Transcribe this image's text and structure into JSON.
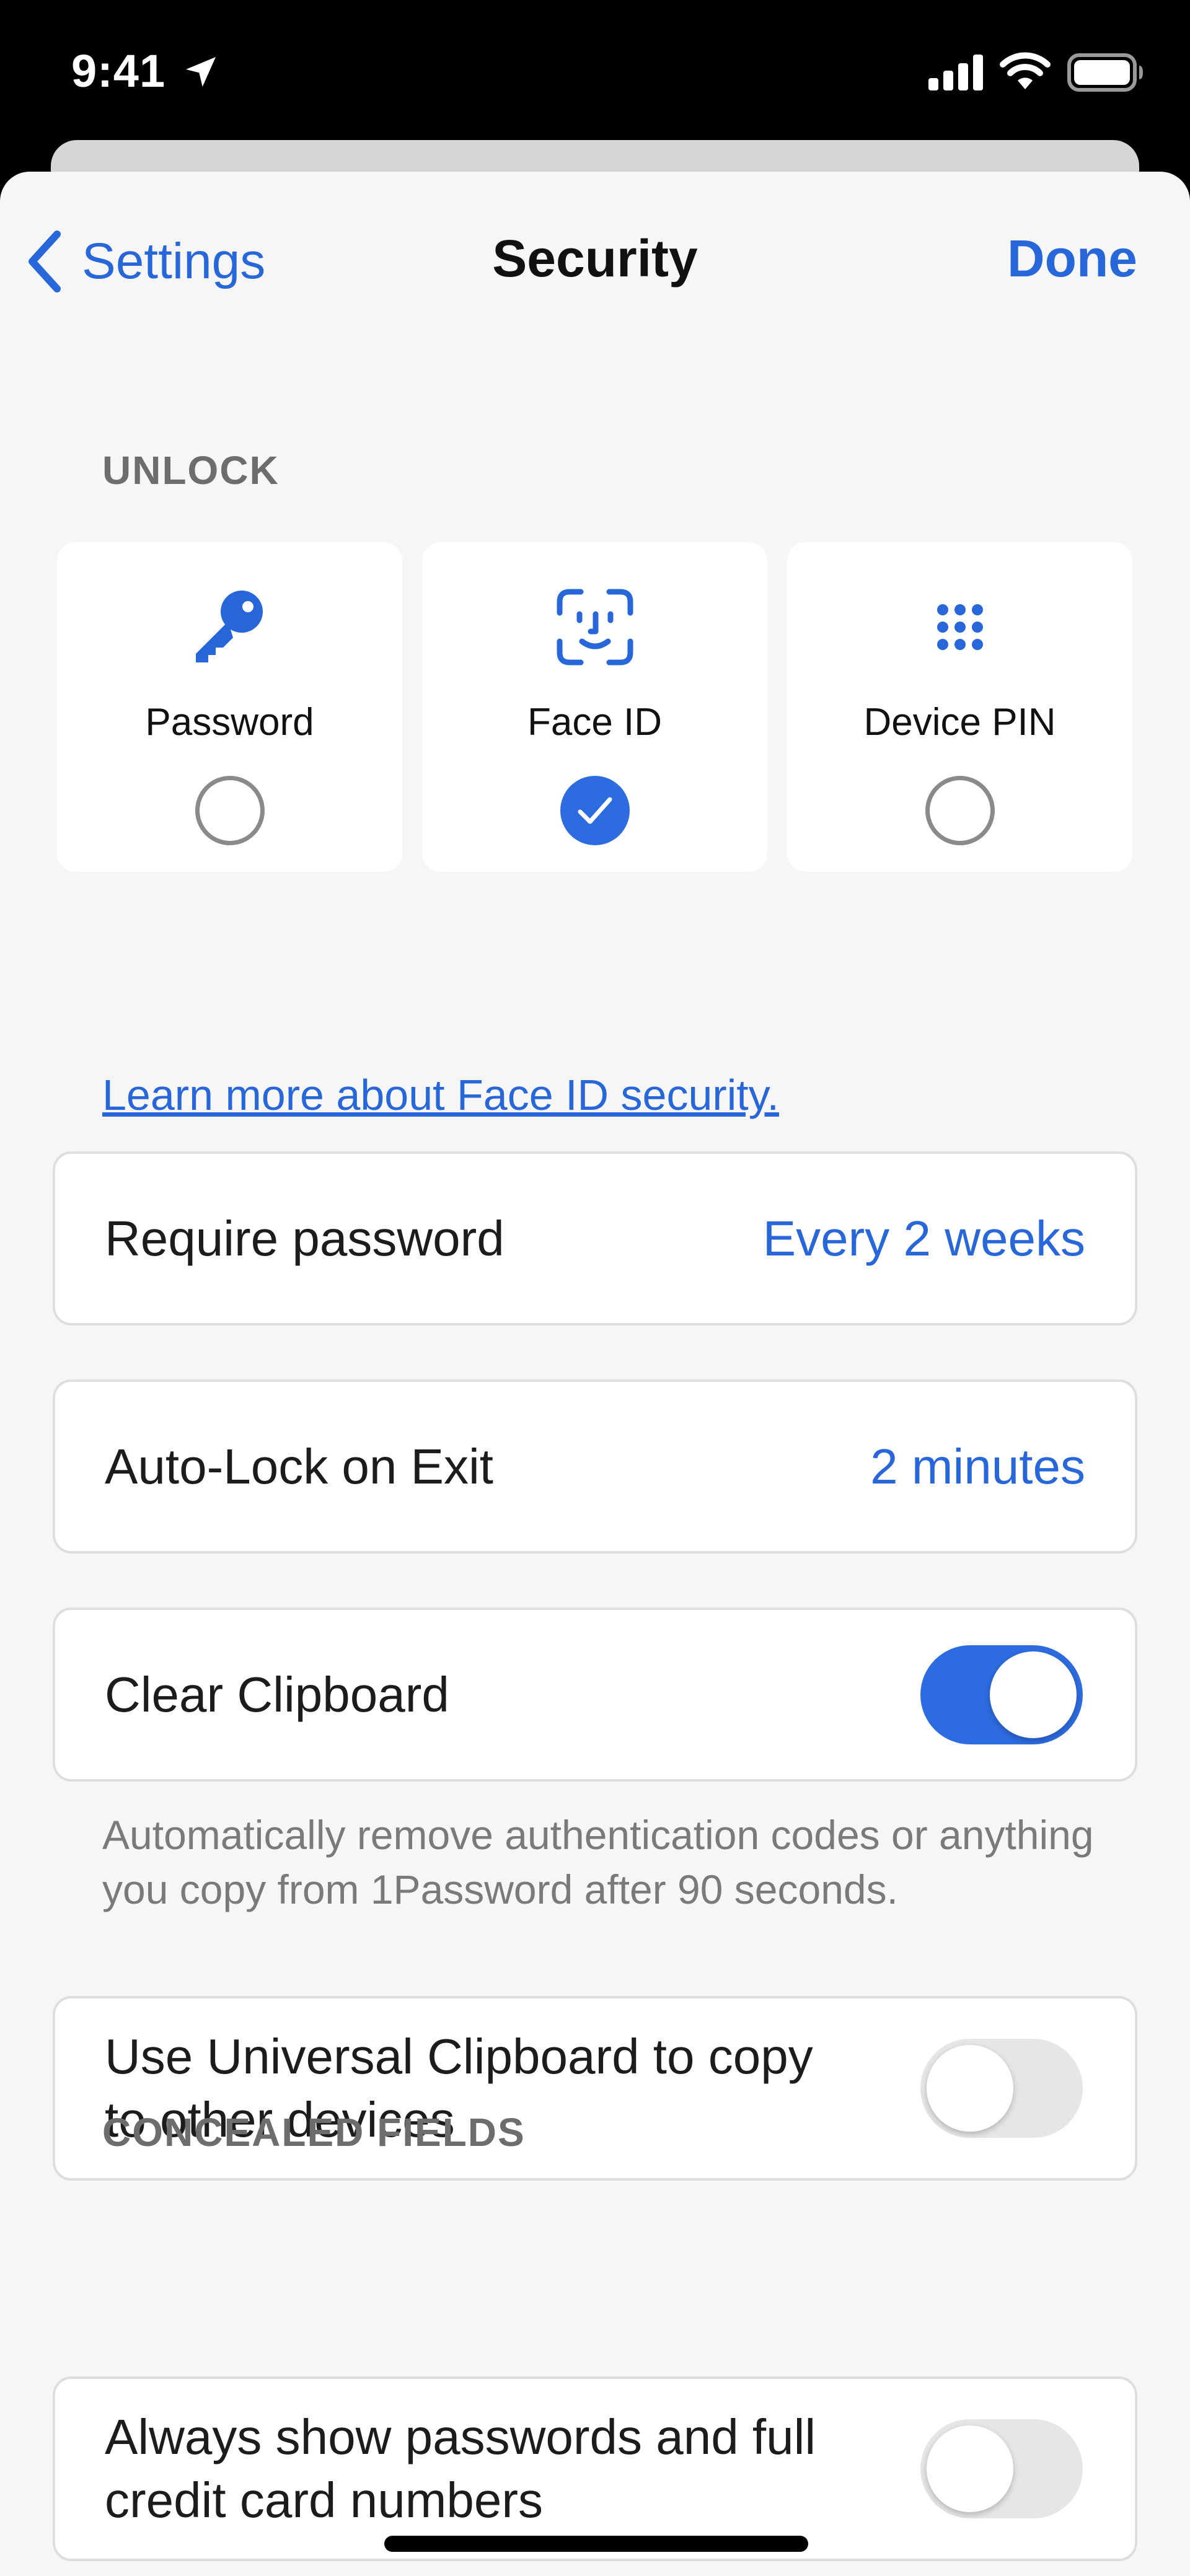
{
  "status_bar": {
    "time": "9:41",
    "icons": [
      "location-arrow-icon",
      "cellular-signal-icon",
      "wifi-icon",
      "battery-icon"
    ]
  },
  "nav": {
    "back_label": "Settings",
    "title": "Security",
    "done_label": "Done"
  },
  "unlock": {
    "header": "UNLOCK",
    "options": [
      {
        "label": "Password",
        "icon": "key-icon",
        "selected": false
      },
      {
        "label": "Face ID",
        "icon": "face-id-icon",
        "selected": true
      },
      {
        "label": "Device PIN",
        "icon": "keypad-icon",
        "selected": false
      }
    ],
    "learn_more": "Learn more about Face ID security."
  },
  "settings": {
    "require_password": {
      "label": "Require password",
      "value": "Every 2 weeks"
    },
    "auto_lock": {
      "label": "Auto-Lock on Exit",
      "value": "2 minutes"
    },
    "clear_clipboard": {
      "label": "Clear Clipboard",
      "enabled": true,
      "footnote": "Automatically remove authentication codes or anything you copy from 1Password after 90 seconds."
    },
    "universal_clipboard": {
      "label_line1": "Use Universal Clipboard to copy",
      "label_line2": "to other devices",
      "enabled": false
    }
  },
  "concealed": {
    "header": "CONCEALED FIELDS",
    "always_show": {
      "label_line1": "Always show passwords and full",
      "label_line2": "credit card numbers",
      "enabled": false
    }
  },
  "colors": {
    "accent": "#2867d9",
    "toggle_on": "#2d6be0",
    "background": "#f6f6f6"
  }
}
